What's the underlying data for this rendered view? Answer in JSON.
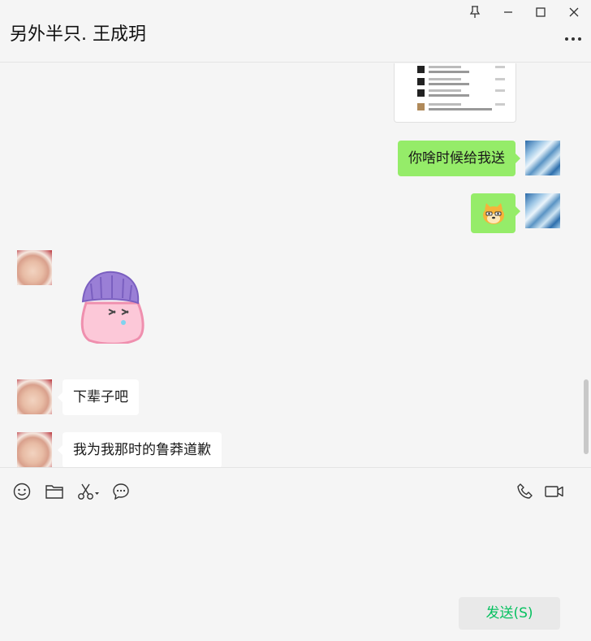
{
  "window": {
    "title": "另外半只. 王成玥",
    "controls": [
      "pin-icon",
      "minimize-icon",
      "maximize-icon",
      "close-icon"
    ],
    "more_icon": "more-icon"
  },
  "messages": [
    {
      "type": "screenshot",
      "from": "self"
    },
    {
      "type": "text",
      "from": "self",
      "text": "你啥时候给我送"
    },
    {
      "type": "emoji",
      "from": "self",
      "emoji": "doge-emoji"
    },
    {
      "type": "sticker",
      "from": "other",
      "sticker": "pink-blob-purple-beanie-sticker"
    },
    {
      "type": "text",
      "from": "other",
      "text": "下辈子吧"
    },
    {
      "type": "text",
      "from": "other",
      "text": "我为我那时的鲁莽道歉"
    }
  ],
  "toolbar": {
    "left_icons": [
      "emoji-icon",
      "folder-icon",
      "scissors-icon",
      "chat-bubble-icon"
    ],
    "right_icons": [
      "phone-icon",
      "video-call-icon"
    ],
    "send_label": "发送(S)"
  },
  "colors": {
    "self_bubble": "#95ec69",
    "other_bubble": "#ffffff",
    "send_text": "#07c160",
    "background": "#f5f5f5"
  }
}
